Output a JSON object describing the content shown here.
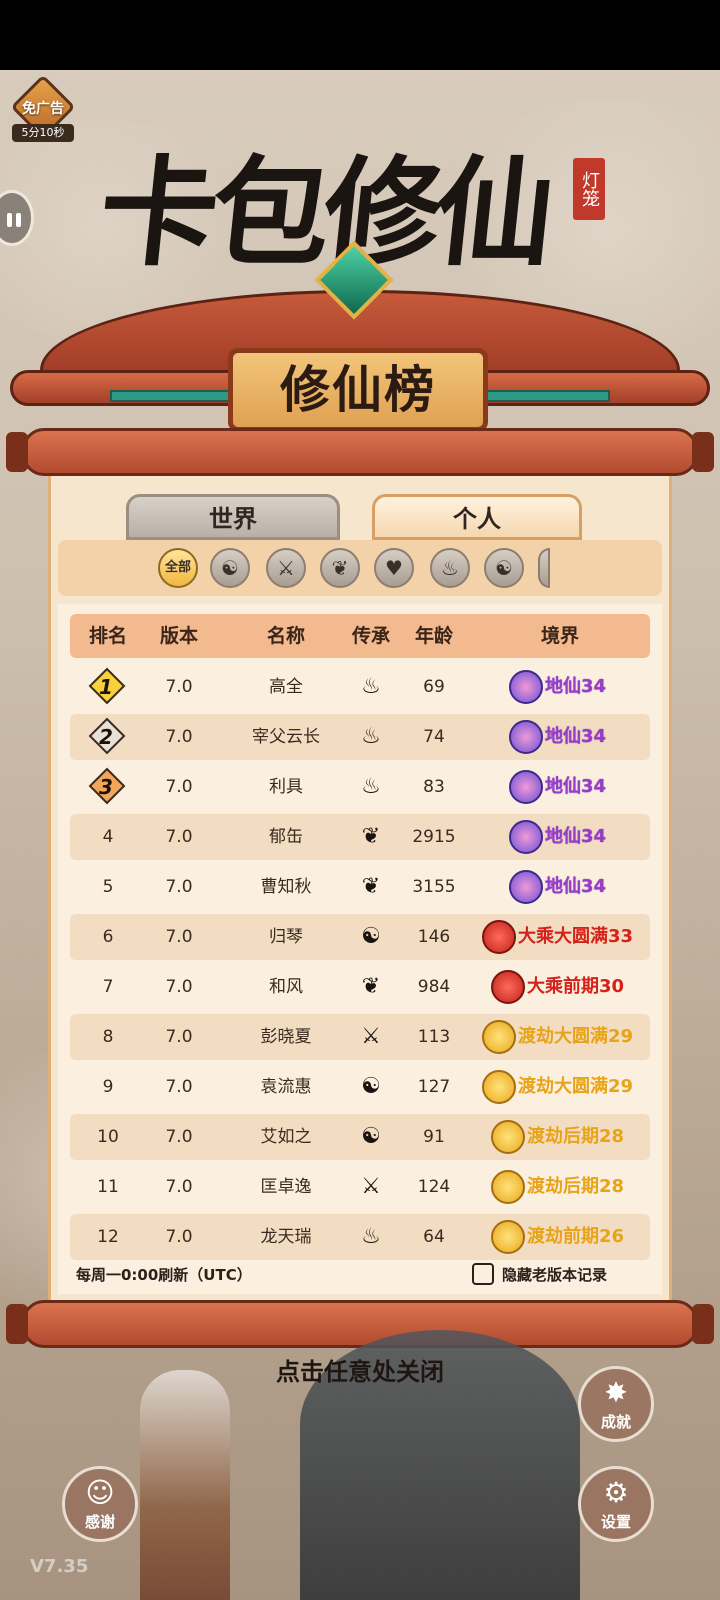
{
  "ad_badge": {
    "label": "免广告",
    "timer": "5分10秒"
  },
  "logo": {
    "title": "卡包修仙",
    "seal": "灯笼"
  },
  "plaque": {
    "title": "修仙榜"
  },
  "tabs": [
    {
      "label": "世界",
      "selected": false
    },
    {
      "label": "个人",
      "selected": true
    }
  ],
  "filters": {
    "all_label": "全部",
    "icons": [
      "taiji-icon",
      "sword-emblem-icon",
      "book-icon",
      "heart-icon",
      "flame-icon",
      "yin-yang-icon",
      "partial-icon"
    ]
  },
  "table": {
    "headers": [
      "排名",
      "版本",
      "名称",
      "传承",
      "年龄",
      "境界"
    ],
    "rows": [
      {
        "rank": "1",
        "version": "7.0",
        "name": "高全",
        "lineage": "flame-icon",
        "age": "69",
        "realm": "地仙34",
        "realm_type": "purple"
      },
      {
        "rank": "2",
        "version": "7.0",
        "name": "宰父云长",
        "lineage": "flame-icon",
        "age": "74",
        "realm": "地仙34",
        "realm_type": "purple"
      },
      {
        "rank": "3",
        "version": "7.0",
        "name": "利具",
        "lineage": "flame-icon",
        "age": "83",
        "realm": "地仙34",
        "realm_type": "purple"
      },
      {
        "rank": "4",
        "version": "7.0",
        "name": "郁缶",
        "lineage": "book-icon",
        "age": "2915",
        "realm": "地仙34",
        "realm_type": "purple"
      },
      {
        "rank": "5",
        "version": "7.0",
        "name": "曹知秋",
        "lineage": "book-icon",
        "age": "3155",
        "realm": "地仙34",
        "realm_type": "purple"
      },
      {
        "rank": "6",
        "version": "7.0",
        "name": "归琴",
        "lineage": "yin-yang-icon",
        "age": "146",
        "realm": "大乘大圆满33",
        "realm_type": "red"
      },
      {
        "rank": "7",
        "version": "7.0",
        "name": "和风",
        "lineage": "book-icon",
        "age": "984",
        "realm": "大乘前期30",
        "realm_type": "red"
      },
      {
        "rank": "8",
        "version": "7.0",
        "name": "彭晓夏",
        "lineage": "sword-emblem-icon",
        "age": "113",
        "realm": "渡劫大圆满29",
        "realm_type": "gold"
      },
      {
        "rank": "9",
        "version": "7.0",
        "name": "袁流惠",
        "lineage": "yin-yang-icon",
        "age": "127",
        "realm": "渡劫大圆满29",
        "realm_type": "gold"
      },
      {
        "rank": "10",
        "version": "7.0",
        "name": "艾如之",
        "lineage": "yin-yang-icon",
        "age": "91",
        "realm": "渡劫后期28",
        "realm_type": "gold"
      },
      {
        "rank": "11",
        "version": "7.0",
        "name": "匡卓逸",
        "lineage": "sword-emblem-icon",
        "age": "124",
        "realm": "渡劫后期28",
        "realm_type": "gold"
      },
      {
        "rank": "12",
        "version": "7.0",
        "name": "龙天瑞",
        "lineage": "flame-icon",
        "age": "64",
        "realm": "渡劫前期26",
        "realm_type": "gold"
      }
    ]
  },
  "footer": {
    "refresh_note": "每周一0:00刷新（UTC）",
    "hide_old_label": "隐藏老版本记录",
    "hide_old_checked": false
  },
  "close_hint": "点击任意处关闭",
  "buttons": {
    "achievement": "成就",
    "thanks": "感谢",
    "settings": "设置"
  },
  "version": "V7.35",
  "colors": {
    "accent_red": "#d4221a",
    "accent_gold": "#e8a418",
    "accent_purple": "#9b3cc7",
    "scroll_paper": "#f6e6cd"
  }
}
